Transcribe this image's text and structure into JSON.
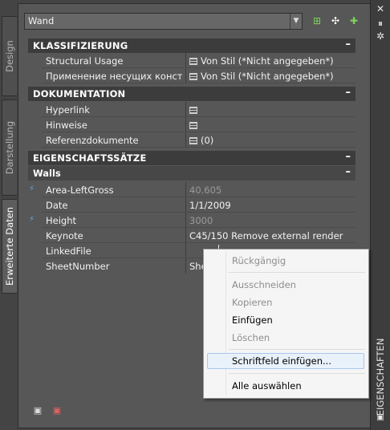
{
  "vertical_tabs": [
    "Design",
    "Darstellung",
    "Erweiterte Daten"
  ],
  "right_bar": {
    "title": "EIGENSCHAFTEN"
  },
  "selector": {
    "value": "Wand"
  },
  "sections": {
    "klass": {
      "title": "KLASSIFIZIERUNG",
      "collapse": "–"
    },
    "doku": {
      "title": "DOKUMENTATION",
      "collapse": "–"
    },
    "eig": {
      "title": "EIGENSCHAFTSSÄTZE",
      "collapse": "–"
    },
    "walls": {
      "title": "Walls",
      "collapse": "–"
    }
  },
  "klass_rows": [
    {
      "name": "Structural Usage",
      "value": "Von Stil (*Nicht angegeben*)"
    },
    {
      "name": "Применение несущих конст...",
      "value": "Von Stil (*Nicht angegeben*)"
    }
  ],
  "doku_rows": [
    {
      "name": "Hyperlink",
      "value": ""
    },
    {
      "name": "Hinweise",
      "value": ""
    },
    {
      "name": "Referenzdokumente",
      "value": "(0)"
    }
  ],
  "walls_rows": [
    {
      "name": "Area-LeftGross",
      "value": "40.605"
    },
    {
      "name": "Date",
      "value": "1/1/2009"
    },
    {
      "name": "Height",
      "value": "3000"
    },
    {
      "name": "Keynote",
      "value": "C45/150 Remove external render"
    },
    {
      "name": "LinkedFile",
      "value": ""
    },
    {
      "name": "SheetNumber",
      "value": "She"
    }
  ],
  "context_menu": {
    "undo": "Rückgängig",
    "cut": "Ausschneiden",
    "copy": "Kopieren",
    "paste": "Einfügen",
    "delete": "Löschen",
    "insert_field": "Schriftfeld einfügen...",
    "select_all": "Alle auswählen"
  }
}
